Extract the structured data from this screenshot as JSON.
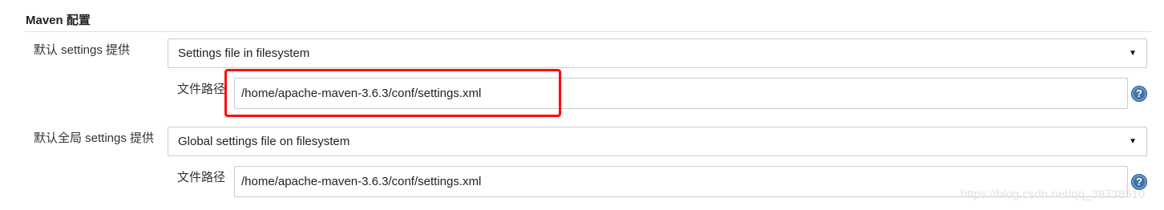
{
  "section": {
    "title": "Maven 配置"
  },
  "settings": {
    "label": "默认 settings 提供",
    "select_value": "Settings file in filesystem",
    "path_label": "文件路径",
    "path_value": "/home/apache-maven-3.6.3/conf/settings.xml"
  },
  "global_settings": {
    "label": "默认全局 settings 提供",
    "select_value": "Global settings file on filesystem",
    "path_label": "文件路径",
    "path_value": "/home/apache-maven-3.6.3/conf/settings.xml"
  },
  "icons": {
    "dropdown": "▼",
    "help": "?"
  },
  "colors": {
    "highlight": "#ff0a0a",
    "help_icon": "#3f73a8"
  },
  "watermark": "https://blog.csdn.net/qq_38738510"
}
